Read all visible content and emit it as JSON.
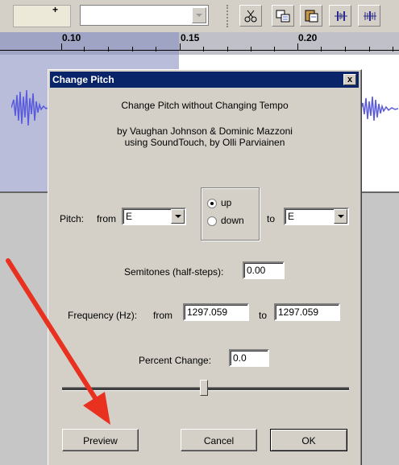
{
  "timeline": {
    "labels": [
      "0.10",
      "0.15",
      "0.20"
    ]
  },
  "toolbar": {
    "plus": "+"
  },
  "dialog": {
    "title": "Change Pitch",
    "close": "x",
    "heading": "Change Pitch without Changing Tempo",
    "credits_line1": "by Vaughan Johnson & Dominic Mazzoni",
    "credits_line2": "using SoundTouch, by Olli Parviainen",
    "pitch_label": "Pitch:",
    "from_label": "from",
    "from_value": "E",
    "to_label": "to",
    "to_value": "E",
    "direction": {
      "up": "up",
      "down": "down",
      "selected": "up"
    },
    "semitones_label": "Semitones (half-steps):",
    "semitones_value": "0.00",
    "frequency_label": "Frequency (Hz):",
    "freq_from_label": "from",
    "freq_from_value": "1297.059",
    "freq_to_label": "to",
    "freq_to_value": "1297.059",
    "percent_label": "Percent Change:",
    "percent_value": "0.0",
    "preview_button": "Preview",
    "cancel_button": "Cancel",
    "ok_button": "OK"
  },
  "colors": {
    "annotation_arrow": "#e8311f",
    "titlebar": "#0a246a",
    "waveform": "#5a5adc"
  }
}
